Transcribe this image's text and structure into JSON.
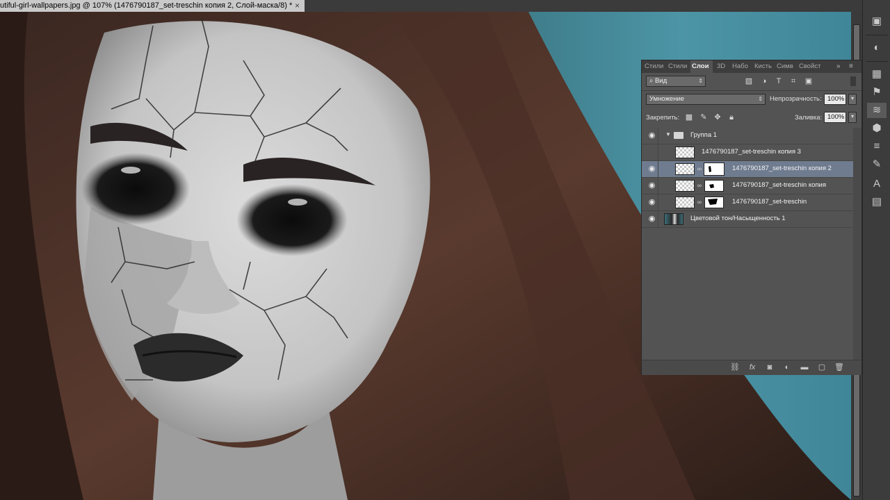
{
  "document_tab": {
    "title": "utiful-girl-wallpapers.jpg @ 107% (1476790187_set-treschin копия 2, Слой-маска/8) *",
    "close_glyph": "×"
  },
  "layers_panel": {
    "tabs": [
      "Стили",
      "Стили",
      "Слои",
      "3D",
      "Набо",
      "Кисть",
      "Симв",
      "Свойст"
    ],
    "active_tab": "Слои",
    "filter": {
      "search_icon": "⌕",
      "value": "Вид"
    },
    "blend_mode": "Умножение",
    "opacity_label": "Непрозрачность:",
    "opacity_value": "100%",
    "lock_label": "Закрепить:",
    "fill_label": "Заливка:",
    "fill_value": "100%",
    "layers": [
      {
        "name": "Группа 1",
        "type": "group",
        "visible": true,
        "selected": false
      },
      {
        "name": "1476790187_set-treschin копия 3",
        "type": "pixel",
        "visible": false,
        "selected": false,
        "has_mask": false
      },
      {
        "name": "1476790187_set-treschin копия 2",
        "type": "pixel",
        "visible": true,
        "selected": true,
        "has_mask": true
      },
      {
        "name": "1476790187_set-treschin копия",
        "type": "pixel",
        "visible": true,
        "selected": false,
        "has_mask": true
      },
      {
        "name": "1476790187_set-treschin",
        "type": "pixel",
        "visible": true,
        "selected": false,
        "has_mask": true
      },
      {
        "name": "Цветовой тон/Насыщенность 1",
        "type": "adjustment",
        "visible": true,
        "selected": false
      }
    ]
  },
  "colors": {
    "panel_bg": "#535353",
    "selected_row": "#6f7b8f",
    "canvas_teal": "#3b7d8b"
  }
}
